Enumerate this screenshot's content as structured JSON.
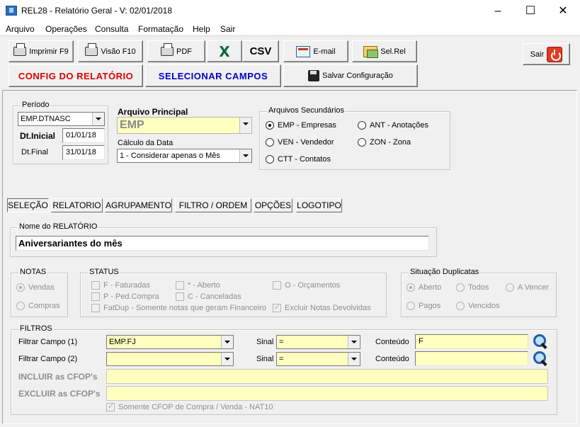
{
  "window": {
    "title": "REL28 - Relatório Geral - V: 02/01/2018"
  },
  "menu": [
    "Arquivo",
    "Operações",
    "Consulta",
    "Formatação",
    "Help",
    "Sair"
  ],
  "toolbar": {
    "imprimir": "Imprimir F9",
    "visao": "Visão F10",
    "pdf": "PDF",
    "csv": "CSV",
    "email": "E-mail",
    "selrel": "Sel.Rel",
    "sair": "Sair",
    "config": "CONFIG  DO  RELATÓRIO",
    "selecionar": "SELECIONAR  CAMPOS",
    "salvar": "Salvar Configuração",
    "config_color": "#e00000",
    "selecionar_color": "#0000cc"
  },
  "periodo": {
    "legend": "Período",
    "campo": "EMP.DTNASC",
    "dt_inicial_label": "Dt.Inicial",
    "dt_inicial": "01/01/18",
    "dt_final_label": "Dt.Final",
    "dt_final": "31/01/18"
  },
  "arquivo_principal": {
    "label": "Arquivo Principal",
    "value": "EMP",
    "calculo_label": "Cálculo da Data",
    "calculo_value": "1 - Considerar apenas o Mês"
  },
  "arquivos_secundarios": {
    "legend": "Arquivos Secundários",
    "options": [
      "EMP - Empresas",
      "ANT - Anotações",
      "VEN - Vendedor",
      "ZON - Zona",
      "CTT - Contatos"
    ],
    "selected": "EMP - Empresas"
  },
  "tabs": [
    "SELEÇÃO",
    "RELATORIO",
    "AGRUPAMENTO",
    "FILTRO / ORDEM",
    "OPÇÕES",
    "LOGOTIPO"
  ],
  "nome_relatorio": {
    "legend": "Nome do RELATÓRIO",
    "value": "Aniversariantes do mês"
  },
  "notas": {
    "legend": "NOTAS",
    "vendas": "Vendas",
    "compras": "Compras"
  },
  "status": {
    "legend": "STATUS",
    "faturadas": "F - Faturadas",
    "aberto": "* - Aberto",
    "orcamentos": "O - Orçamentos",
    "ped_compra": "P - Ped.Compra",
    "canceladas": "C - Canceladas",
    "fatdup": "FatDup - Somente notas que geram Financeiro",
    "excluir_devolvidas": "Excluir Notas Devolvidas"
  },
  "situacao": {
    "legend": "Situação Duplicatas",
    "aberto": "Aberto",
    "todos": "Todos",
    "a_vencer": "A Vencer",
    "pagos": "Pagos",
    "vencidos": "Vencidos"
  },
  "filtros": {
    "legend": "FILTROS",
    "filtrar1_label": "Filtrar Campo (1)",
    "filtrar1_value": "EMP.FJ",
    "sinal_label": "Sinal",
    "sinal1": "=",
    "conteudo_label": "Conteúdo",
    "conteudo1": "F",
    "filtrar2_label": "Filtrar Campo (2)",
    "filtrar2_value": "",
    "sinal2": "=",
    "conteudo2": "",
    "incluir_label": "INCLUIR as CFOP's",
    "excluir_label": "EXCLUIR as CFOP's",
    "somente_cfop": "Somente CFOP de  Compra / Venda - NAT10"
  }
}
